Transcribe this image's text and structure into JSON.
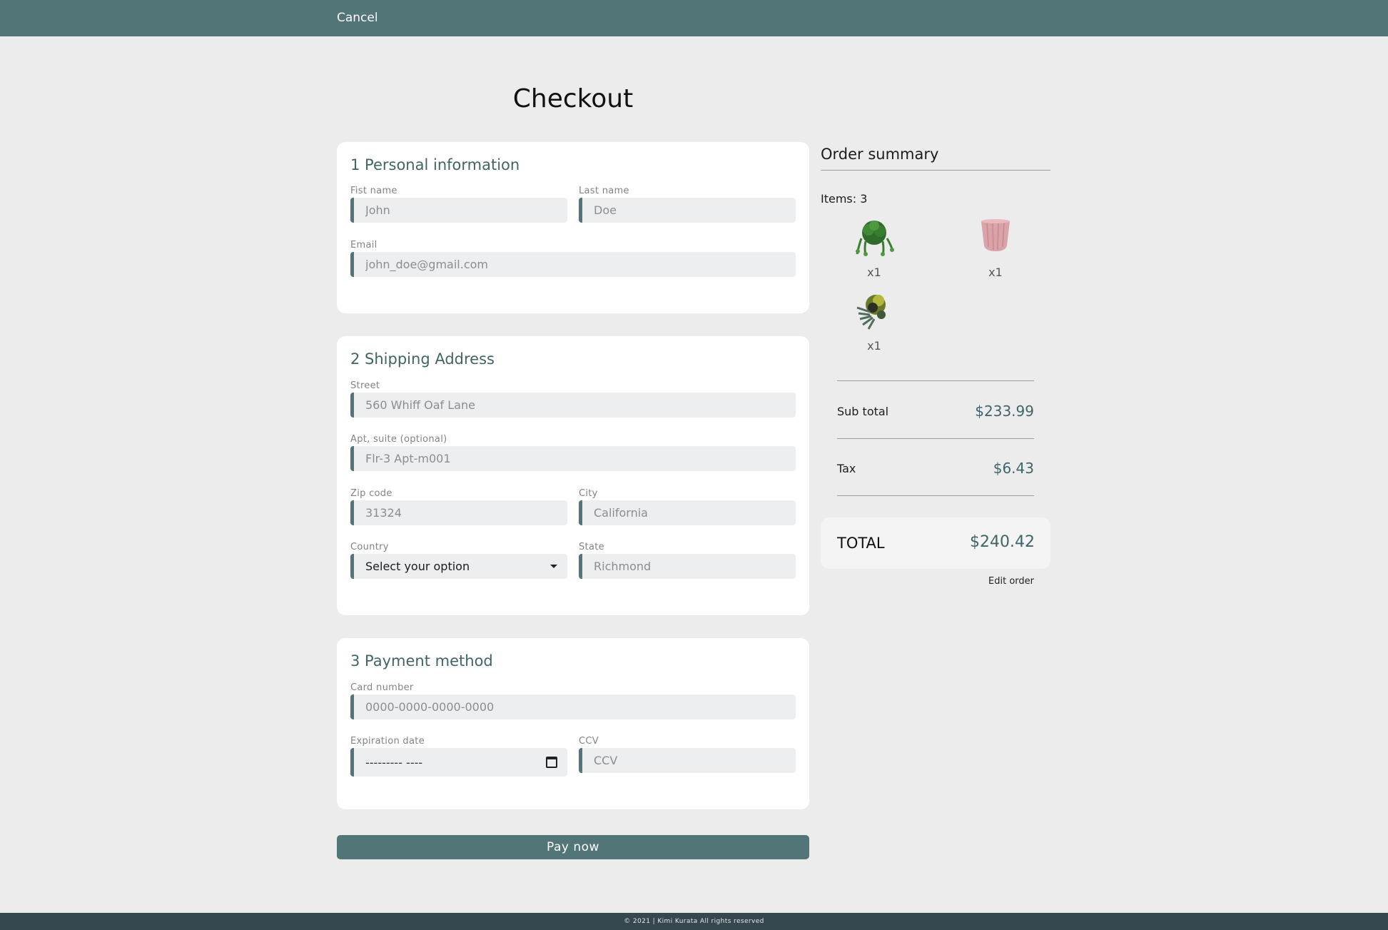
{
  "topbar": {
    "cancel_label": "Cancel"
  },
  "page_title": "Checkout",
  "personal": {
    "title": "1 Personal information",
    "first_name": {
      "label": "Fist name",
      "placeholder": "John"
    },
    "last_name": {
      "label": "Last name",
      "placeholder": "Doe"
    },
    "email": {
      "label": "Email",
      "placeholder": "john_doe@gmail.com"
    }
  },
  "shipping": {
    "title": "2 Shipping Address",
    "street": {
      "label": "Street",
      "placeholder": "560 Whiff Oaf Lane"
    },
    "apt": {
      "label": "Apt, suite (optional)",
      "placeholder": "Flr-3 Apt-m001"
    },
    "zip": {
      "label": "Zip code",
      "placeholder": "31324"
    },
    "city": {
      "label": "City",
      "placeholder": "California"
    },
    "country": {
      "label": "Country",
      "selected": "Select your option"
    },
    "state": {
      "label": "State",
      "placeholder": "Richmond"
    }
  },
  "payment": {
    "title": "3 Payment method",
    "card_number": {
      "label": "Card number",
      "placeholder": "0000-0000-0000-0000"
    },
    "expiration": {
      "label": "Expiration date",
      "value": "--------- ----"
    },
    "ccv": {
      "label": "CCV",
      "placeholder": "CCV"
    }
  },
  "pay_label": "Pay now",
  "summary": {
    "title": "Order summary",
    "items_label": "Items: 3",
    "products": [
      {
        "name": "hanging-plant",
        "qty": "x1"
      },
      {
        "name": "pink-pot",
        "qty": "x1"
      },
      {
        "name": "succulent-arrangement",
        "qty": "x1"
      }
    ],
    "subtotal_label": "Sub total",
    "subtotal_value": "$233.99",
    "tax_label": "Tax",
    "tax_value": "$6.43",
    "total_label": "TOTAL",
    "total_value": "$240.42",
    "edit_label": "Edit order"
  },
  "footer": "© 2021 | Kimi Kurata All rights reserved",
  "colors": {
    "accent": "#527577",
    "heading": "#3f6567",
    "background": "#ececec",
    "footer": "#37474f"
  }
}
